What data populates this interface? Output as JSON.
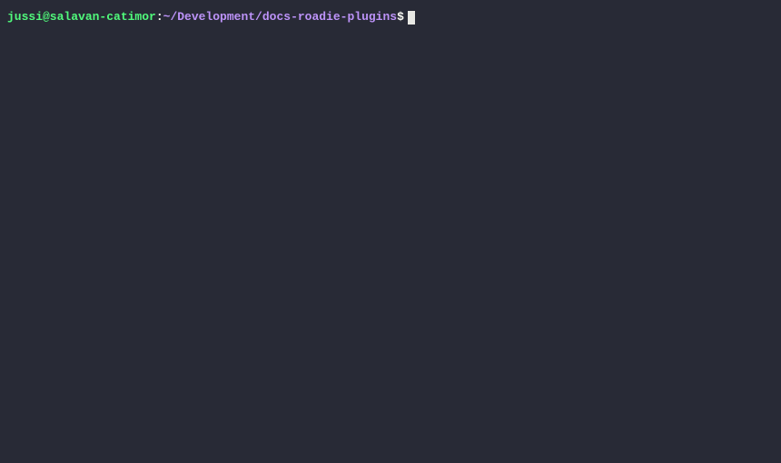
{
  "prompt": {
    "user_host": "jussi@salavan-catimor",
    "colon": ":",
    "path": "~/Development/docs-roadie-plugins",
    "symbol": "$"
  },
  "command": {
    "value": ""
  }
}
